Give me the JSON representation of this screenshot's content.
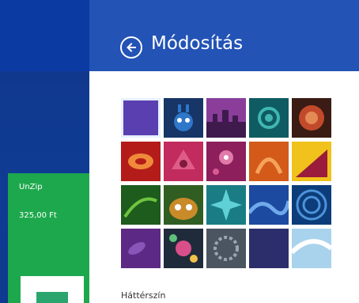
{
  "app_tile": {
    "name": "UnZip",
    "price": "325,00 Ft"
  },
  "panel": {
    "title": "Módosítás",
    "section_label": "Háttérszín"
  },
  "patterns": [
    {
      "name": "solid purple",
      "selected": true
    },
    {
      "name": "blue creature"
    },
    {
      "name": "purple city"
    },
    {
      "name": "teal swirls"
    },
    {
      "name": "red flower"
    },
    {
      "name": "red pattern"
    },
    {
      "name": "pink bird"
    },
    {
      "name": "magenta flowers"
    },
    {
      "name": "orange swirl"
    },
    {
      "name": "yellow triangle"
    },
    {
      "name": "green leaf"
    },
    {
      "name": "owl"
    },
    {
      "name": "teal star"
    },
    {
      "name": "blue wave"
    },
    {
      "name": "blue circles"
    },
    {
      "name": "purple leaves"
    },
    {
      "name": "flower lace"
    },
    {
      "name": "gray gears"
    },
    {
      "name": "dark blue"
    },
    {
      "name": "white wave"
    }
  ]
}
